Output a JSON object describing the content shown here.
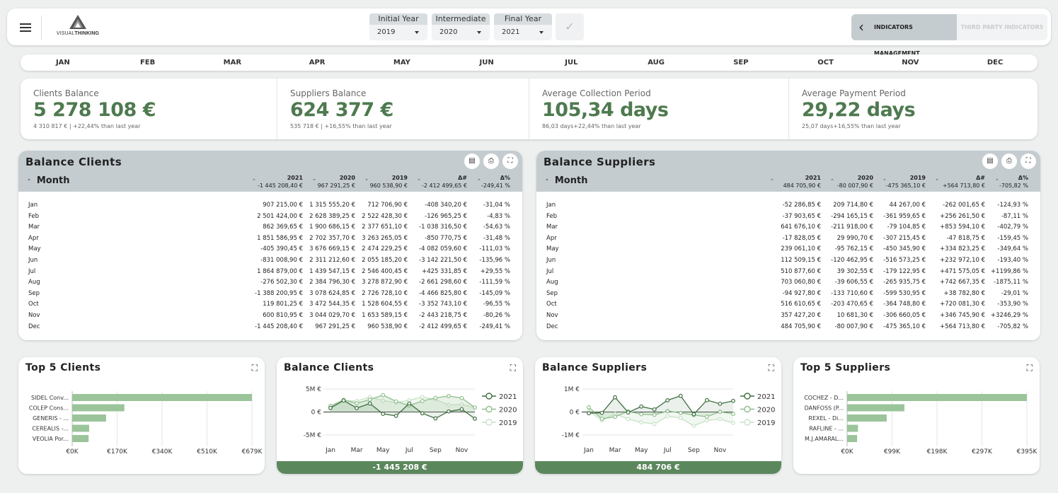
{
  "header": {
    "logo_text_light": "VISUAL",
    "logo_text_bold": "THINKING",
    "initial_year_label": "Initial Year",
    "initial_year_value": "2019",
    "intermediate_label": "Intermediate",
    "intermediate_value": "2020",
    "final_year_label": "Final Year",
    "final_year_value": "2021",
    "indicators_management": "INDICATORS MANAGEMENT",
    "third_party_indicators": "THIRD PARTY INDICATORS"
  },
  "months": [
    "JAN",
    "FEB",
    "MAR",
    "APR",
    "MAY",
    "JUN",
    "JUL",
    "AUG",
    "SEP",
    "OCT",
    "NOV",
    "DEC"
  ],
  "kpis": [
    {
      "label": "Clients Balance",
      "value": "5 278 108 €",
      "sub": "4 310 817 € | +22,44% than last year"
    },
    {
      "label": "Suppliers Balance",
      "value": "624 377 €",
      "sub": "535 718 € | +16,55% than last year"
    },
    {
      "label": "Average Collection Period",
      "value": "105,34 days",
      "sub": "86,03 days+22,44% than last year"
    },
    {
      "label": "Average Payment Period",
      "value": "29,22 days",
      "sub": "25,07 days+16,55% than last year"
    }
  ],
  "tables": [
    {
      "title": "Balance Clients",
      "month_header": "Month",
      "cols": [
        {
          "h": "2021",
          "t": "-1 445 208,40 €"
        },
        {
          "h": "2020",
          "t": "967 291,25 €"
        },
        {
          "h": "2019",
          "t": "960 538,90 €"
        },
        {
          "h": "Δ#",
          "t": "-2 412 499,65 €"
        },
        {
          "h": "Δ%",
          "t": "-249,41 %"
        }
      ],
      "rows": [
        [
          "Jan",
          "907 215,00 €",
          "1 315 555,20 €",
          "712 706,90 €",
          "-408 340,20 €",
          "-31,04 %"
        ],
        [
          "Feb",
          "2 501 424,00 €",
          "2 628 389,25 €",
          "2 522 428,30 €",
          "-126 965,25 €",
          "-4,83 %"
        ],
        [
          "Mar",
          "862 369,65 €",
          "1 900 686,15 €",
          "2 377 651,10 €",
          "-1 038 316,50 €",
          "-54,63 %"
        ],
        [
          "Apr",
          "1 851 586,95 €",
          "2 702 357,70 €",
          "3 263 265,05 €",
          "-850 770,75 €",
          "-31,48 %"
        ],
        [
          "May",
          "-405 390,45 €",
          "3 676 669,15 €",
          "2 474 229,25 €",
          "-4 082 059,60 €",
          "-111,03 %"
        ],
        [
          "Jun",
          "-831 008,90 €",
          "2 311 212,60 €",
          "2 055 185,20 €",
          "-3 142 221,50 €",
          "-135,96 %"
        ],
        [
          "Jul",
          "1 864 879,00 €",
          "1 439 547,15 €",
          "2 546 400,45 €",
          "+425 331,85 €",
          "+29,55 %"
        ],
        [
          "Aug",
          "-276 502,30 €",
          "2 384 796,30 €",
          "3 278 872,90 €",
          "-2 661 298,60 €",
          "-111,59 %"
        ],
        [
          "Sep",
          "-1 388 200,95 €",
          "3 078 624,85 €",
          "2 726 728,10 €",
          "-4 466 825,80 €",
          "-145,09 %"
        ],
        [
          "Oct",
          "119 801,25 €",
          "3 472 544,35 €",
          "1 528 604,55 €",
          "-3 352 743,10 €",
          "-96,55 %"
        ],
        [
          "Nov",
          "600 810,95 €",
          "3 044 029,70 €",
          "1 653 589,15 €",
          "-2 443 218,75 €",
          "-80,26 %"
        ],
        [
          "Dec",
          "-1 445 208,40 €",
          "967 291,25 €",
          "960 538,90 €",
          "-2 412 499,65 €",
          "-249,41 %"
        ]
      ]
    },
    {
      "title": "Balance Suppliers",
      "month_header": "Month",
      "cols": [
        {
          "h": "2021",
          "t": "484 705,90 €"
        },
        {
          "h": "2020",
          "t": "-80 007,90 €"
        },
        {
          "h": "2019",
          "t": "-475 365,10 €"
        },
        {
          "h": "Δ#",
          "t": "+564 713,80 €"
        },
        {
          "h": "Δ%",
          "t": "-705,82 %"
        }
      ],
      "rows": [
        [
          "Jan",
          "-52 286,85 €",
          "209 714,80 €",
          "44 267,00 €",
          "-262 001,65 €",
          "-124,93 %"
        ],
        [
          "Feb",
          "-37 903,65 €",
          "-294 165,15 €",
          "-361 959,65 €",
          "+256 261,50 €",
          "-87,11 %"
        ],
        [
          "Mar",
          "641 676,10 €",
          "-211 918,00 €",
          "-79 104,85 €",
          "+853 594,10 €",
          "-402,79 %"
        ],
        [
          "Apr",
          "-17 828,05 €",
          "29 990,70 €",
          "-307 215,45 €",
          "-47 818,75 €",
          "-159,45 %"
        ],
        [
          "May",
          "239 061,10 €",
          "-95 762,15 €",
          "-450 345,90 €",
          "+334 823,25 €",
          "-349,64 %"
        ],
        [
          "Jun",
          "112 509,15 €",
          "-120 462,95 €",
          "-516 573,25 €",
          "+232 972,10 €",
          "-193,40 %"
        ],
        [
          "Jul",
          "510 877,60 €",
          "39 302,55 €",
          "-179 122,95 €",
          "+471 575,05 €",
          "+1199,86 %"
        ],
        [
          "Aug",
          "703 060,80 €",
          "-39 606,55 €",
          "-265 935,75 €",
          "+742 667,35 €",
          "-1875,11 %"
        ],
        [
          "Sep",
          "-94 927,80 €",
          "-133 710,60 €",
          "-599 530,95 €",
          "+38 782,80 €",
          "-29,01 %"
        ],
        [
          "Oct",
          "516 610,65 €",
          "-203 470,65 €",
          "-364 748,80 €",
          "+720 081,30 €",
          "-353,90 %"
        ],
        [
          "Nov",
          "357 427,20 €",
          "10 681,30 €",
          "-306 660,05 €",
          "+346 745,90 €",
          "+3246,29 %"
        ],
        [
          "Dec",
          "484 705,90 €",
          "-80 007,90 €",
          "-475 365,10 €",
          "+564 713,80 €",
          "-705,82 %"
        ]
      ]
    }
  ],
  "charts": [
    {
      "title": "Top 5 Clients",
      "footer": ""
    },
    {
      "title": "Balance Clients",
      "footer": "-1 445 208 €"
    },
    {
      "title": "Balance Suppliers",
      "footer": "484 706 €"
    },
    {
      "title": "Top 5 Suppliers",
      "footer": ""
    }
  ],
  "colors": {
    "accent": "#4e7a4f",
    "bar": "#9bc49a",
    "s2021": "#3f6e40",
    "s2020": "#8fbf8e",
    "s2019": "#c8e1c7"
  },
  "chart_data": [
    {
      "type": "bar",
      "orientation": "horizontal",
      "title": "Top 5 Clients",
      "categories": [
        "SIDEL Conv...",
        "COLEP Cons...",
        "GENERIS - ...",
        "CEREALIS -...",
        "VEOLIA Por..."
      ],
      "values": [
        679,
        197,
        128,
        64,
        62
      ],
      "ticks": [
        "€0K",
        "€170K",
        "€340K",
        "€510K",
        "€679K"
      ],
      "xlim": [
        0,
        679
      ]
    },
    {
      "type": "line",
      "title": "Balance Clients",
      "categories": [
        "Jan",
        "Feb",
        "Mar",
        "Apr",
        "May",
        "Jun",
        "Jul",
        "Aug",
        "Sep",
        "Oct",
        "Nov",
        "Dec"
      ],
      "xticks": [
        "Jan",
        "Mar",
        "May",
        "Jul",
        "Sep",
        "Nov"
      ],
      "yticks": [
        "5M €",
        "0 €",
        "-5M €"
      ],
      "ylim": [
        -5000000,
        5000000
      ],
      "series": [
        {
          "name": "2021",
          "values": [
            907215,
            2501424,
            862370,
            1851587,
            -405390,
            -831009,
            1864879,
            -276502,
            -1388201,
            119801,
            600811,
            -1445208
          ]
        },
        {
          "name": "2020",
          "values": [
            1315555,
            2628389,
            1900686,
            2702358,
            3676669,
            2311213,
            1439547,
            2384796,
            3078625,
            3472544,
            3044030,
            967291
          ]
        },
        {
          "name": "2019",
          "values": [
            712707,
            2522428,
            2377651,
            3263265,
            2474229,
            2055185,
            2546400,
            3278873,
            2726728,
            1528605,
            1653589,
            960539
          ]
        }
      ]
    },
    {
      "type": "line",
      "title": "Balance Suppliers",
      "categories": [
        "Jan",
        "Feb",
        "Mar",
        "Apr",
        "May",
        "Jun",
        "Jul",
        "Aug",
        "Sep",
        "Oct",
        "Nov",
        "Dec"
      ],
      "xticks": [
        "Jan",
        "Mar",
        "May",
        "Jul",
        "Sep",
        "Nov"
      ],
      "yticks": [
        "1M €",
        "0 €",
        "-1M €"
      ],
      "ylim": [
        -1000000,
        1000000
      ],
      "series": [
        {
          "name": "2021",
          "values": [
            -52287,
            -37904,
            641676,
            -17828,
            239061,
            112509,
            510878,
            703061,
            -94928,
            516611,
            357427,
            484706
          ]
        },
        {
          "name": "2020",
          "values": [
            209715,
            -294165,
            -211918,
            29991,
            -95762,
            -120463,
            39303,
            -39607,
            -133711,
            -203471,
            10681,
            -80008
          ]
        },
        {
          "name": "2019",
          "values": [
            44267,
            -361960,
            -79105,
            -307215,
            -450346,
            -516573,
            -179123,
            -265936,
            -599531,
            -364749,
            -306660,
            -475365
          ]
        }
      ]
    },
    {
      "type": "bar",
      "orientation": "horizontal",
      "title": "Top 5 Suppliers",
      "categories": [
        "COCHEZ - D...",
        "DANFOSS (P...",
        "REXEL - Di...",
        "RAFLINE - ...",
        "M.J.AMARAL..."
      ],
      "values": [
        395,
        126,
        87,
        24,
        22
      ],
      "ticks": [
        "€0K",
        "€99K",
        "€198K",
        "€297K",
        "€395K"
      ],
      "xlim": [
        0,
        395
      ]
    }
  ]
}
